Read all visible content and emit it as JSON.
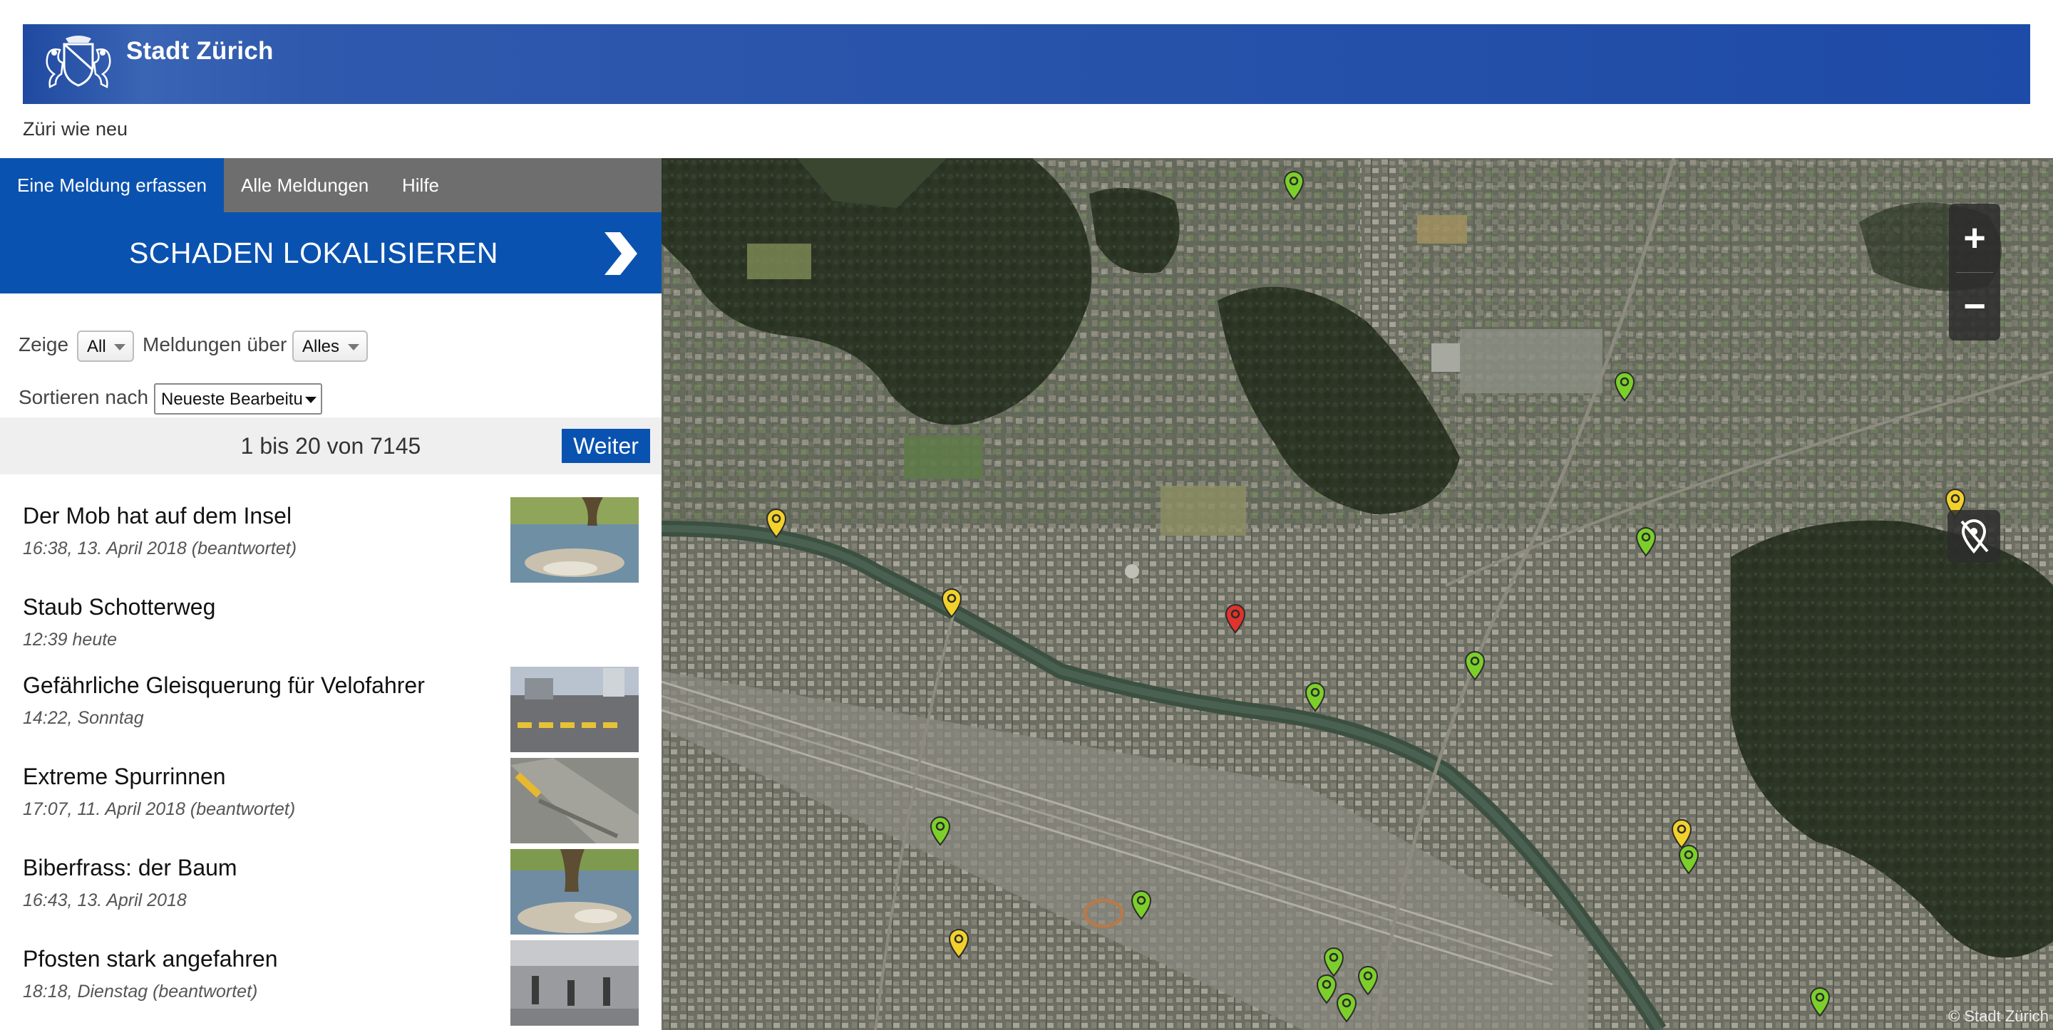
{
  "header": {
    "brand": "Stadt Zürich",
    "subtitle": "Züri wie neu",
    "brand_color": "#1f4aa0"
  },
  "nav": {
    "tabs": [
      {
        "label": "Eine Meldung erfassen",
        "active": true
      },
      {
        "label": "Alle Meldungen",
        "active": false
      },
      {
        "label": "Hilfe",
        "active": false
      }
    ]
  },
  "cta": {
    "label": "SCHADEN LOKALISIEREN",
    "icon": "chevron-right-icon"
  },
  "filters": {
    "show_label": "Zeige",
    "show_value": "All",
    "reports_about_label": "Meldungen über",
    "reports_about_value": "Alles",
    "sort_label": "Sortieren nach",
    "sort_value": "Neueste Bearbeitu"
  },
  "pager": {
    "text": "1 bis 20 von 7145",
    "next_label": "Weiter"
  },
  "reports": [
    {
      "title": "Der Mob hat auf dem Insel",
      "meta": "16:38, 13. April 2018 (beantwortet)",
      "thumb": "river-stone"
    },
    {
      "title": "Staub Schotterweg",
      "meta": "12:39 heute",
      "thumb": null
    },
    {
      "title": "Gefährliche Gleisquerung für Velofahrer",
      "meta": "14:22, Sonntag",
      "thumb": "street-crossing"
    },
    {
      "title": "Extreme Spurrinnen",
      "meta": "17:07, 11. April 2018 (beantwortet)",
      "thumb": "asphalt"
    },
    {
      "title": "Biberfrass: der Baum",
      "meta": "16:43, 13. April 2018",
      "thumb": "river-bank"
    },
    {
      "title": "Pfosten stark angefahren",
      "meta": "18:18, Dienstag (beantwortet)",
      "thumb": "bollards"
    }
  ],
  "map": {
    "zoom_in": "+",
    "zoom_out": "−",
    "attribution": "© Stadt Zürich",
    "pin_colors": {
      "green": "#7ccf2a",
      "yellow": "#f2d12b",
      "red": "#e0332b"
    },
    "pins": [
      {
        "status": "green"
      },
      {
        "status": "green"
      },
      {
        "status": "yellow"
      },
      {
        "status": "green"
      },
      {
        "status": "yellow"
      },
      {
        "status": "yellow"
      },
      {
        "status": "red"
      },
      {
        "status": "green"
      },
      {
        "status": "green"
      },
      {
        "status": "green"
      },
      {
        "status": "yellow"
      },
      {
        "status": "green"
      },
      {
        "status": "green"
      },
      {
        "status": "yellow"
      },
      {
        "status": "green"
      },
      {
        "status": "green"
      },
      {
        "status": "green"
      },
      {
        "status": "green"
      },
      {
        "status": "green"
      }
    ]
  }
}
